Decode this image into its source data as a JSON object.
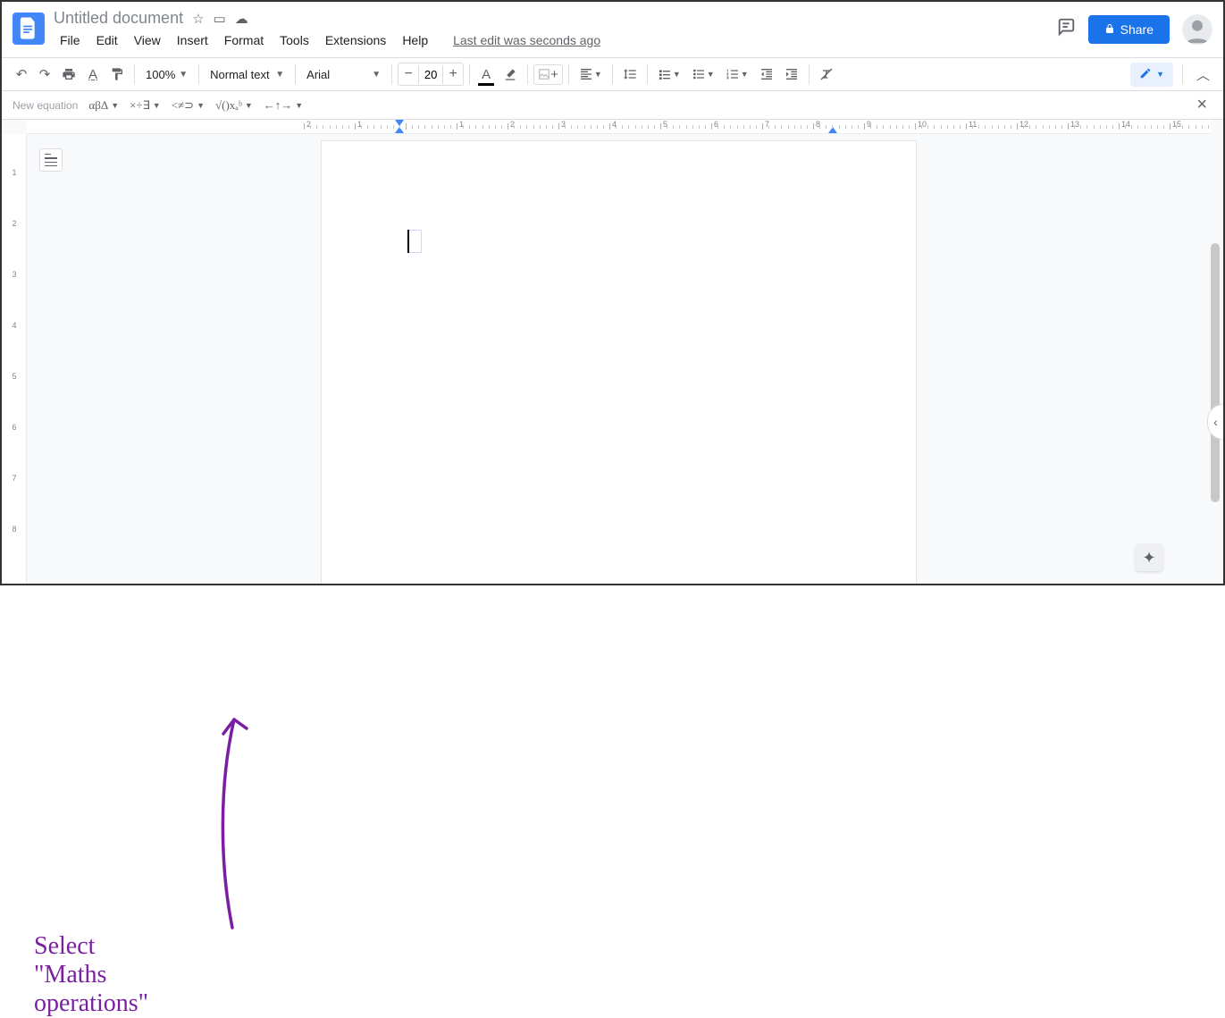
{
  "header": {
    "title": "Untitled document",
    "last_edit": "Last edit was seconds ago",
    "share_label": "Share"
  },
  "menubar": [
    "File",
    "Edit",
    "View",
    "Insert",
    "Format",
    "Tools",
    "Extensions",
    "Help"
  ],
  "toolbar": {
    "zoom": "100%",
    "style": "Normal text",
    "font": "Arial",
    "fontsize": "20"
  },
  "equation_bar": {
    "label": "New equation",
    "greek": "αβΔ",
    "misc": "×÷∃",
    "relations": "<≠⊃",
    "math": "√()xₐᵇ",
    "arrows": "←↑→"
  },
  "ruler": {
    "ticks": [
      2,
      1,
      "",
      1,
      2,
      3,
      4,
      5,
      6,
      7,
      8,
      9,
      10,
      11,
      12,
      13,
      14,
      15
    ]
  },
  "ruler_v": [
    1,
    2,
    3,
    4,
    5,
    6,
    7,
    8
  ],
  "annotation_text": "Select \"Maths operations\""
}
